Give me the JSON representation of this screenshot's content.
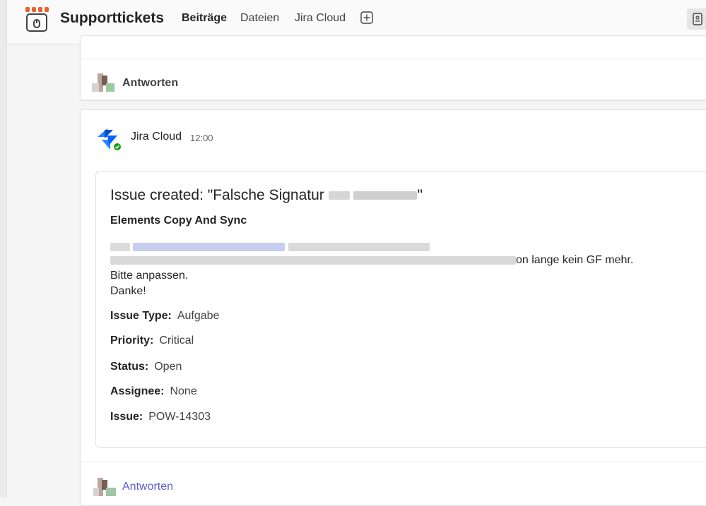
{
  "header": {
    "title": "Supporttickets",
    "tabs": [
      {
        "label": "Beiträge",
        "active": true
      },
      {
        "label": "Dateien",
        "active": false
      },
      {
        "label": "Jira Cloud",
        "active": false
      }
    ],
    "accent_color": "#5b5fc7"
  },
  "top_card": {
    "reply_label": "Antworten"
  },
  "post": {
    "sender": "Jira Cloud",
    "time": "12:00",
    "card": {
      "title_prefix": "Issue created: \"Falsche Signatur",
      "title_suffix": "\"",
      "subtitle": "Elements Copy And Sync",
      "description_tail": "on lange kein GF mehr.",
      "description_lines": [
        "Bitte anpassen.",
        "Danke!"
      ],
      "facts": [
        {
          "key": "Issue Type:",
          "value": "Aufgabe"
        },
        {
          "key": "Priority:",
          "value": "Critical"
        },
        {
          "key": "Status:",
          "value": "Open"
        },
        {
          "key": "Assignee:",
          "value": "None"
        },
        {
          "key": "Issue:",
          "value": "POW-14303"
        }
      ]
    },
    "reply_label": "Antworten"
  }
}
